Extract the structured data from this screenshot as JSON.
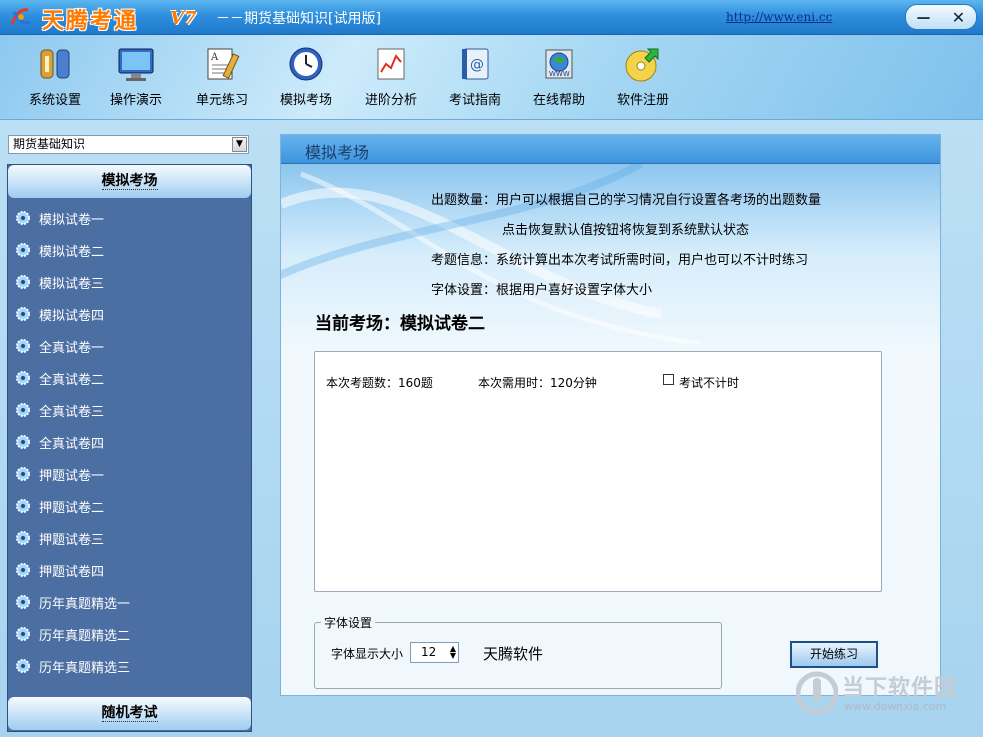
{
  "window": {
    "brand": "天腾考通",
    "version": "V7",
    "subtitle": "－－期货基础知识[试用版]",
    "url": "http://www.eni.cc",
    "controls": {
      "minimize": "－",
      "close": "✕"
    }
  },
  "toolbar": {
    "items": [
      {
        "label": "系统设置",
        "icon": "tools-icon"
      },
      {
        "label": "操作演示",
        "icon": "monitor-icon"
      },
      {
        "label": "单元练习",
        "icon": "document-icon"
      },
      {
        "label": "模拟考场",
        "icon": "clock-icon"
      },
      {
        "label": "进阶分析",
        "icon": "chart-icon"
      },
      {
        "label": "考试指南",
        "icon": "address-book-icon"
      },
      {
        "label": "在线帮助",
        "icon": "globe-icon"
      },
      {
        "label": "软件注册",
        "icon": "cd-icon"
      }
    ]
  },
  "sidebar": {
    "book_select": "期货基础知识",
    "section1": "模拟考场",
    "section2": "随机考试",
    "items": [
      "模拟试卷一",
      "模拟试卷二",
      "模拟试卷三",
      "模拟试卷四",
      "全真试卷一",
      "全真试卷二",
      "全真试卷三",
      "全真试卷四",
      "押题试卷一",
      "押题试卷二",
      "押题试卷三",
      "押题试卷四",
      "历年真题精选一",
      "历年真题精选二",
      "历年真题精选三"
    ]
  },
  "main": {
    "header": "模拟考场",
    "info": {
      "line1": "出题数量：用户可以根据自己的学习情况自行设置各考场的出题数量",
      "line2": "点击恢复默认值按钮将恢复到系统默认状态",
      "line3": "考题信息：系统计算出本次考试所需时间，用户也可以不计时练习",
      "line4": "字体设置：根据用户喜好设置字体大小"
    },
    "current_label": "当前考场：模拟试卷二",
    "question_count": "本次考题数：160题",
    "time_needed": "本次需用时：120分钟",
    "no_timer_label": "考试不计时",
    "no_timer_checked": false,
    "font_group_title": "字体设置",
    "font_size_label": "字体显示大小",
    "font_size_value": "12",
    "sample_text": "天腾软件",
    "start_button": "开始练习"
  },
  "watermark": {
    "text": "当下软件园",
    "url": "www.downxia.com"
  }
}
